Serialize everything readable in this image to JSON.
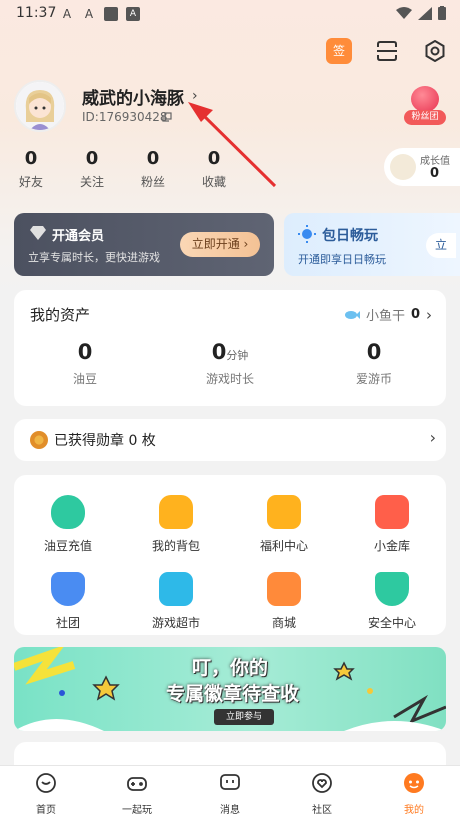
{
  "status": {
    "time": "11:37"
  },
  "header": {
    "sign_label": "签"
  },
  "profile": {
    "nickname": "威武的小海豚",
    "uid": "ID:176930428",
    "fans_label": "粉丝团"
  },
  "stats": [
    {
      "value": "0",
      "label": "好友"
    },
    {
      "value": "0",
      "label": "关注"
    },
    {
      "value": "0",
      "label": "粉丝"
    },
    {
      "value": "0",
      "label": "收藏"
    }
  ],
  "growth": {
    "label": "成长值",
    "value": "0"
  },
  "vip": {
    "title": "开通会员",
    "subtitle": "立享专属时长，更快进游戏",
    "button": "立即开通 ›"
  },
  "day_pass": {
    "title": "包日畅玩",
    "subtitle": "开通即享日日畅玩",
    "button": "立"
  },
  "assets": {
    "title": "我的资产",
    "fish_label": "小鱼干",
    "fish_value": "0",
    "items": [
      {
        "value": "0",
        "unit": "",
        "label": "油豆"
      },
      {
        "value": "0",
        "unit": "分钟",
        "label": "游戏时长"
      },
      {
        "value": "0",
        "unit": "",
        "label": "爱游币"
      }
    ]
  },
  "medal": {
    "text": "已获得勋章 0 枚"
  },
  "grid": [
    {
      "label": "油豆充值",
      "icon": "bean-icon",
      "color": "#2ec9a0"
    },
    {
      "label": "我的背包",
      "icon": "backpack-icon",
      "color": "#ffb21e"
    },
    {
      "label": "福利中心",
      "icon": "gift-icon",
      "color": "#ffb21e"
    },
    {
      "label": "小金库",
      "icon": "vault-icon",
      "color": "#ff5f4a"
    },
    {
      "label": "社团",
      "icon": "club-icon",
      "color": "#4a8cf2"
    },
    {
      "label": "游戏超市",
      "icon": "cart-icon",
      "color": "#2eb9e8"
    },
    {
      "label": "商城",
      "icon": "store-icon",
      "color": "#ff8a3a"
    },
    {
      "label": "安全中心",
      "icon": "shield-icon",
      "color": "#2ec9a0"
    }
  ],
  "banner": {
    "line1": "叮，你的",
    "line2": "专属徽章待查收",
    "button": "立即参与"
  },
  "tabs": [
    {
      "label": "首页",
      "icon": "home-icon"
    },
    {
      "label": "一起玩",
      "icon": "gamepad-icon"
    },
    {
      "label": "消息",
      "icon": "message-icon"
    },
    {
      "label": "社区",
      "icon": "community-icon"
    },
    {
      "label": "我的",
      "icon": "me-icon"
    }
  ],
  "colors": {
    "accent": "#ff7a20",
    "arrow": "#e53030"
  }
}
